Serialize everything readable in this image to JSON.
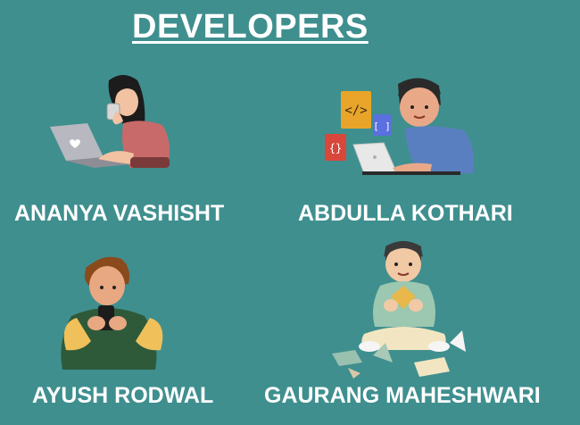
{
  "title": "DEVELOPERS",
  "developers": [
    {
      "name": "ANANYA VASHISHT"
    },
    {
      "name": "ABDULLA KOTHARI"
    },
    {
      "name": "AYUSH RODWAL"
    },
    {
      "name": "GAURANG MAHESHWARI"
    }
  ],
  "colors": {
    "background": "#3f8f8f",
    "text": "#ffffff"
  }
}
